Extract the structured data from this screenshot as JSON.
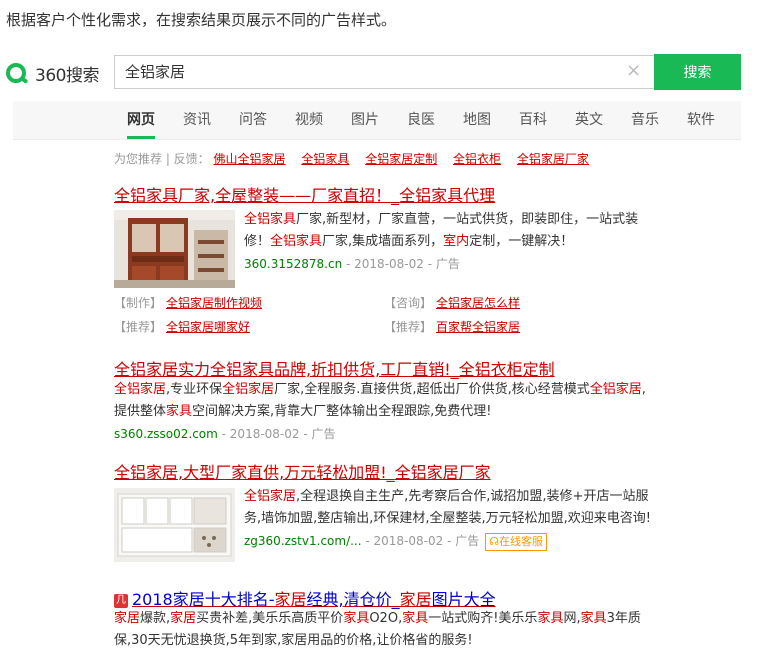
{
  "caption": "根据客户个性化需求，在搜索结果页展示不同的广告样式。",
  "logo": "360搜索",
  "search": {
    "value": "全铝家居",
    "button": "搜索"
  },
  "nav": [
    "网页",
    "资讯",
    "问答",
    "视频",
    "图片",
    "良医",
    "地图",
    "百科",
    "英文",
    "音乐",
    "软件"
  ],
  "recommend": {
    "prefix": "为您推荐 | 反馈：",
    "items": [
      "佛山全铝家居",
      "全铝家具",
      "全铝家居定制",
      "全铝衣柜",
      "全铝家居厂家"
    ]
  },
  "results": [
    {
      "title_parts": [
        "全铝家具",
        "厂家,全屋整装——厂家直招！_",
        "全铝家具代理"
      ],
      "desc_l1": [
        "全铝家具",
        "厂家,新型材，厂家直营，一站式供货，即装即住，一站式装"
      ],
      "desc_l2": [
        "修！",
        "全铝家具",
        "厂家,集成墙面系列，",
        "室内",
        "定制，一键解决！"
      ],
      "url": "360.3152878.cn",
      "date": "2018-08-02",
      "ad": "广告",
      "sublinks": [
        {
          "tag": "【制作】",
          "text": "全铝家居制作视频"
        },
        {
          "tag": "【咨询】",
          "text": "全铝家居怎么样"
        },
        {
          "tag": "【推荐】",
          "text": "全铝家居哪家好"
        },
        {
          "tag": "【推荐】",
          "text": "百家帮全铝家居"
        }
      ]
    },
    {
      "title_parts": [
        "全铝家居",
        "实力全铝家具品牌,折扣供货,工厂直销!_全铝衣柜定制"
      ],
      "desc_l1": [
        "全铝家居",
        ",专业环保",
        "全铝家居",
        "厂家,全程服务.直接供货,超低出厂价供货,核心经营模式",
        "全铝家居",
        ","
      ],
      "desc_l2": [
        "提供整体",
        "家具",
        "空间解决方案,背靠大厂整体输出全程跟踪,免费代理!"
      ],
      "url": "s360.zsso02.com",
      "date": "2018-08-02",
      "ad": "广告"
    },
    {
      "title_parts": [
        "全铝家居",
        ",大型厂家直供,万元轻松加盟!_",
        "全铝家居",
        "厂家"
      ],
      "desc_l1": [
        "全铝家居",
        ",全程退换自主生产,先考察后合作,诚招加盟,装修+开店一站服"
      ],
      "desc_l2": [
        "务,墙饰加盟,整店输出,环保建材,全屋整装,万元轻松加盟,欢迎来电咨询!"
      ],
      "url": "zg360.zstv1.com/...",
      "date": "2018-08-02",
      "ad": "广告",
      "online": "在线客服"
    },
    {
      "icon": "几",
      "title_parts": [
        "2018家居十大排名-",
        "家居",
        "经典,清仓价_",
        "家居",
        "图片大全"
      ],
      "desc_l1": [
        "家居",
        "爆款,",
        "家居",
        "买贵补差,美乐乐高质平价",
        "家具",
        "O2O,",
        "家具",
        "一站式购齐!美乐乐",
        "家具",
        "网,",
        "家具",
        "3年质"
      ],
      "desc_l2": [
        "保,30天无忧退换货,5年到家,家居用品的价格,让价格省的服务!"
      ]
    }
  ],
  "colors": {
    "accent": "#19b955",
    "link": "#c00",
    "url": "#008000"
  }
}
